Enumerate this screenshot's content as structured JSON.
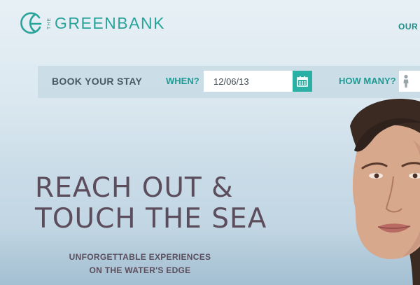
{
  "header": {
    "logo_prefix": "THE",
    "logo_name": "GREENBANK",
    "nav_partial": "OUR"
  },
  "booking": {
    "title": "BOOK YOUR STAY",
    "when_label": "WHEN?",
    "date_value": "12/06/13",
    "how_many_label": "HOW MANY?",
    "guests_icon": "person-icon",
    "calendar_icon": "calendar-icon"
  },
  "hero": {
    "headline_line1": "REACH OUT &",
    "headline_line2": "TOUCH THE SEA",
    "subhead_line1": "UNFORGETTABLE EXPERIENCES",
    "subhead_line2": "ON THE WATER'S EDGE"
  },
  "colors": {
    "brand_teal": "#2aa39a",
    "headline": "#5c4d5d",
    "calendar_button": "#2ab0a5"
  }
}
